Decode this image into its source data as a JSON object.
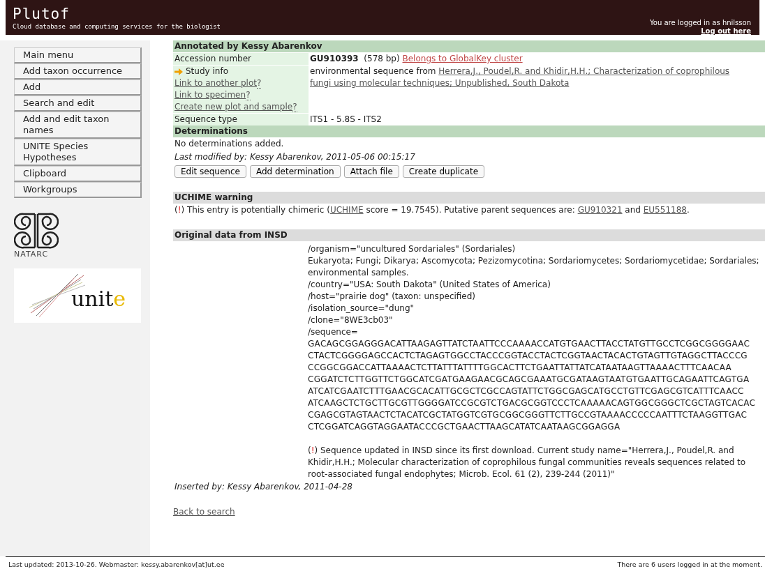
{
  "header": {
    "title": "Plutof",
    "subtitle": "Cloud database and computing services for the biologist",
    "login_text": "You are logged in as hnilsson",
    "logout_link": "Log out here"
  },
  "menu": [
    "Main menu",
    "Add taxon occurrence",
    "Add",
    "Search and edit",
    "Add and edit taxon names",
    "UNITE Species Hypotheses",
    "Clipboard",
    "Workgroups"
  ],
  "logos": {
    "natarc": "NATARC",
    "unite": "unite"
  },
  "annotated": {
    "heading": "Annotated by Kessy Abarenkov",
    "accession": {
      "label": "Accession number",
      "value": "GU910393",
      "bp": "(578 bp)",
      "cluster_link": "Belongs to GlobalKey cluster"
    },
    "study": {
      "label": "Study info",
      "links": [
        {
          "text": "Link to another plot",
          "help": "?"
        },
        {
          "text": "Link to specimen",
          "help": "?"
        },
        {
          "text": "Create new plot and sample",
          "help": "?"
        }
      ],
      "prefix": "environmental sequence from",
      "reference_lines": [
        "Herrera,J., Poudel,R. and Khidir,H.H.; Characterization of coprophilous",
        "fungi using molecular techniques; Unpublished, South Dakota"
      ]
    },
    "sequence_type": {
      "label": "Sequence type",
      "value": "ITS1 - 5.8S - ITS2"
    }
  },
  "determinations": {
    "heading": "Determinations",
    "empty": "No determinations added.",
    "last_modified": "Last modified by: Kessy Abarenkov, 2011-05-06 00:15:17",
    "buttons": [
      "Edit sequence",
      "Add determination",
      "Attach file",
      "Create duplicate"
    ]
  },
  "uchime": {
    "heading": "UCHIME warning",
    "alert": "(!)",
    "text1": "This entry is potentially chimeric (",
    "link": "UCHIME",
    "text2": "score = 19.7545). Putative parent sequences are:",
    "parents": [
      "GU910321",
      "EU551188"
    ],
    "joiner": "and",
    "end": "."
  },
  "insd": {
    "heading": "Original data from INSD",
    "lines": [
      "/organism=\"uncultured Sordariales\" (Sordariales)",
      "Eukaryota; Fungi; Dikarya; Ascomycota; Pezizomycotina; Sordariomycetes; Sordariomycetidae; Sordariales; environmental samples.",
      "/country=\"USA: South Dakota\" (United States of America)",
      "/host=\"prairie dog\" (taxon: unspecified)",
      "/isolation_source=\"dung\"",
      "/clone=\"8WE3cb03\"",
      "/sequence="
    ],
    "sequence": [
      "GACAGCGGAGGGACATTAAGAGTTATCTAATTCCCAAAACCATGTGAACTTACCTATGTTGCCTCGGCGGGGAAC",
      "CTACTCGGGGAGCCACTCTAGAGTGGCCTACCCGGTACCTACTCGGTAACTACACTGTAGTTGTAGGCTTACCCG",
      "CCGGCGGACCATTAAAACTCTTATTTATTTTGGCACTTCTGAATTATTATCATAATAAGTTAAAACTTTCAACAA",
      "CGGATCTCTTGGTTCTGGCATCGATGAAGAACGCAGCGAAATGCGATAAGTAATGTGAATTGCAGAATTCAGTGA",
      "ATCATCGAATCTTTGAACGCACATTGCGCTCGCCAGTATTCTGGCGAGCATGCCTGTTCGAGCGTCATTTCAACC",
      "ATCAAGCTCTGCTTGCGTTGGGGATCCGCGTCTGACGCGGTCCCTCAAAAACAGTGGCGGGCTCGCTAGTCACAC",
      "CGAGCGTAGTAACTCTACATCGCTATGGTCGTGCGGCGGGTTCTTGCCGTAAAACCCCCAATTTCTAAGGTTGAC",
      "CTCGGATCAGGTAGGAATACCCGCTGAACTTAAGCATATCAATAAGCGGAGGA"
    ],
    "alert": "(!)",
    "note": "Sequence updated in INSD since its first download. Current study name=\"Herrera,J., Poudel,R. and Khidir,H.H.; Molecular characterization of coprophilous fungal communities reveals sequences related to root-associated fungal endophytes; Microb. Ecol. 61 (2), 239-244 (2011)\""
  },
  "inserted_by": "Inserted by: Kessy Abarenkov, 2011-04-28",
  "back_link": "Back to search",
  "footer": {
    "left": "Last updated: 2013-10-26. Webmaster: kessy.abarenkov[at]ut.ee",
    "right": "There are 6 users logged in at the moment."
  }
}
